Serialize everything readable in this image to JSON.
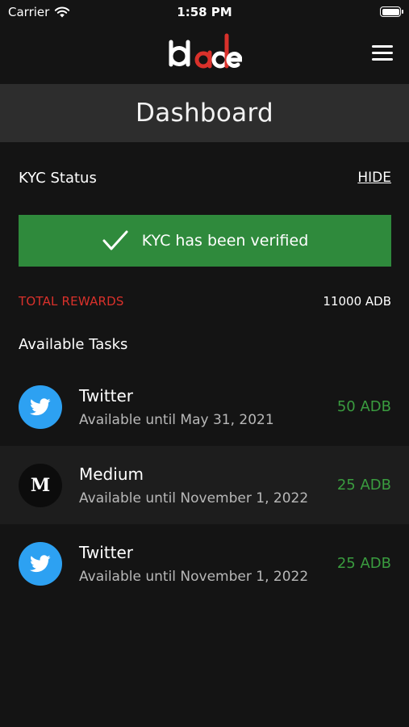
{
  "status_bar": {
    "carrier": "Carrier",
    "time": "1:58 PM"
  },
  "header": {
    "logo_text": "blade",
    "title": "Dashboard"
  },
  "kyc": {
    "label": "KYC Status",
    "hide_label": "HIDE",
    "banner_text": "KYC has been verified"
  },
  "rewards": {
    "label": "TOTAL REWARDS",
    "value": "11000 ADB"
  },
  "tasks": {
    "title": "Available Tasks",
    "items": [
      {
        "name": "Twitter",
        "date": "Available until May 31, 2021",
        "reward": "50 ADB",
        "icon": "twitter-icon",
        "icon_letter": ""
      },
      {
        "name": "Medium",
        "date": "Available until November 1, 2022",
        "reward": "25 ADB",
        "icon": "medium-icon",
        "icon_letter": "M"
      },
      {
        "name": "Twitter",
        "date": "Available until November 1, 2022",
        "reward": "25 ADB",
        "icon": "twitter-icon",
        "icon_letter": ""
      }
    ]
  },
  "colors": {
    "background": "#141414",
    "header_bg": "#2d2d2d",
    "success": "#2f8a3c",
    "accent_red": "#d9312b",
    "reward_green": "#3a9c3f",
    "twitter_blue": "#2da1f2"
  }
}
